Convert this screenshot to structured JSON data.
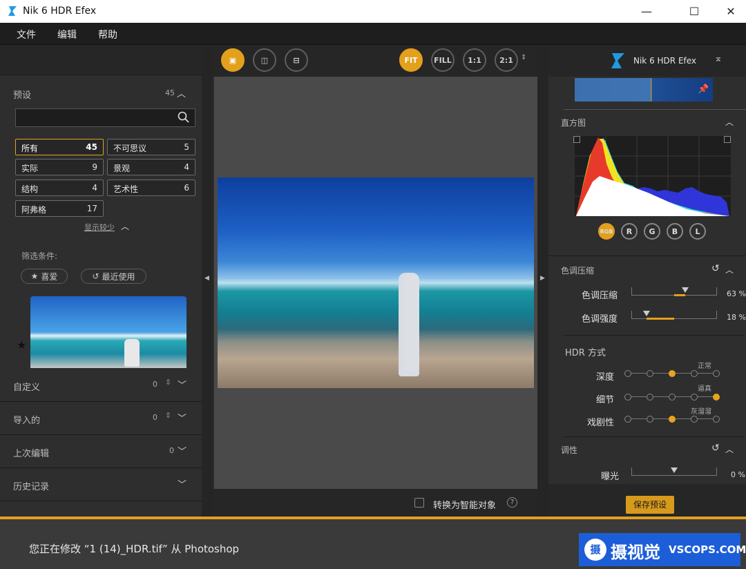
{
  "window": {
    "title": "Nik 6 HDR Efex",
    "minimize": "—",
    "maximize": "☐",
    "close": "✕"
  },
  "menu": [
    "文件",
    "编辑",
    "帮助"
  ],
  "left": {
    "presets_label": "预设",
    "presets_count": "45",
    "search_placeholder": "",
    "categories": [
      {
        "label": "所有",
        "count": "45"
      },
      {
        "label": "不可思议",
        "count": "5"
      },
      {
        "label": "实际",
        "count": "9"
      },
      {
        "label": "景观",
        "count": "4"
      },
      {
        "label": "结构",
        "count": "4"
      },
      {
        "label": "艺术性",
        "count": "6"
      },
      {
        "label": "阿弗格",
        "count": "17"
      }
    ],
    "show_less": "显示较少",
    "filter_label": "筛选条件:",
    "filter_favorites": "喜爱",
    "filter_recent": "最近使用",
    "rows": [
      {
        "label": "自定义",
        "count": "0"
      },
      {
        "label": "导入的",
        "count": "0"
      },
      {
        "label": "上次编辑",
        "count": "0"
      },
      {
        "label": "历史记录",
        "count": ""
      }
    ]
  },
  "center": {
    "zoom_buttons": [
      "FIT",
      "FILL",
      "1:1",
      "2:1"
    ],
    "smart_object_label": "转换为智能对象"
  },
  "right": {
    "brand": "Nik 6 HDR Efex",
    "histogram_label": "直方图",
    "channels": [
      "RGB",
      "R",
      "G",
      "B",
      "L"
    ],
    "tone_compression_section": "色调压缩",
    "tone_compression": {
      "label": "色调压缩",
      "value": "63 %",
      "fraction": 0.63
    },
    "tone_strength": {
      "label": "色调强度",
      "value": "18 %",
      "fraction": 0.18
    },
    "hdr_method_section": "HDR 方式",
    "depth": {
      "label": "深度",
      "tag": "正常",
      "step": 3
    },
    "detail": {
      "label": "细节",
      "tag": "逼真",
      "step": 5
    },
    "drama": {
      "label": "戏剧性",
      "tag": "灰溜溜",
      "step": 3
    },
    "adjust_section": "调性",
    "exposure": {
      "label": "曝光",
      "value": "0 %"
    },
    "save_preset": "保存预设"
  },
  "status": {
    "message": "您正在修改 “1 (14)_HDR.tif” 从 Photoshop",
    "watermark_text": "摄视觉",
    "watermark_site": "VSCOPS.COM"
  },
  "colors": {
    "accent": "#e3a01c",
    "panel": "#2e2e2e"
  }
}
